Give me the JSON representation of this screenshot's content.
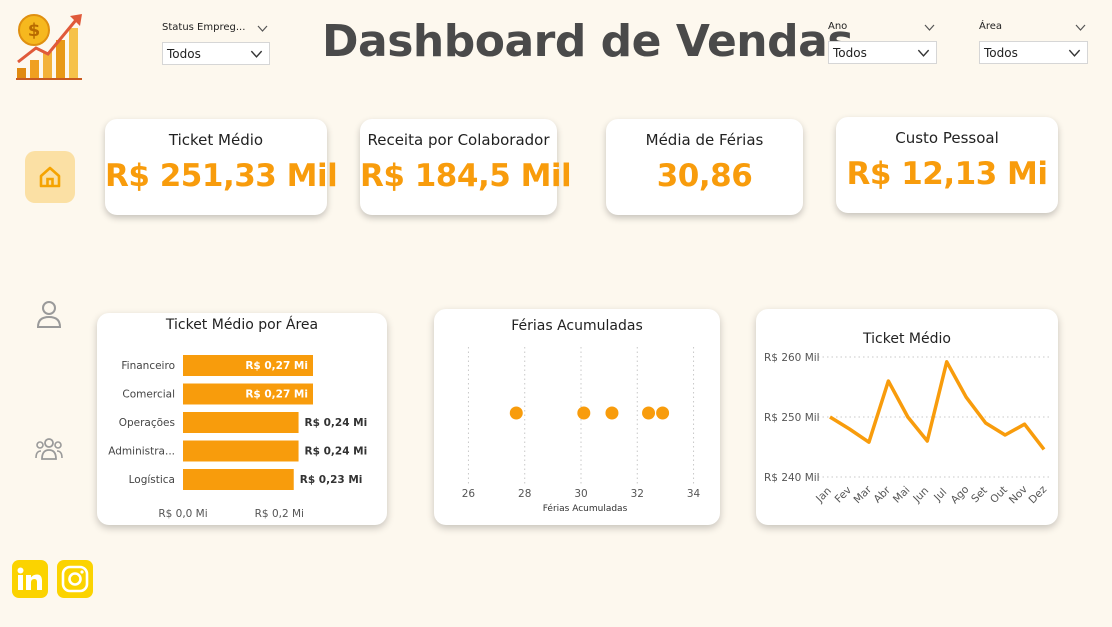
{
  "header": {
    "title": "Dashboard de Vendas"
  },
  "slicers": {
    "status": {
      "label": "Status Empreg...",
      "value": "Todos"
    },
    "ano": {
      "label": "Ano",
      "value": "Todos"
    },
    "area": {
      "label": "Área",
      "value": "Todos"
    }
  },
  "kpis": [
    {
      "title": "Ticket Médio",
      "value": "R$ 251,33 Mil"
    },
    {
      "title": "Receita por Colaborador",
      "value": "R$ 184,5 Mil"
    },
    {
      "title": "Média de Férias",
      "value": "30,86"
    },
    {
      "title": "Custo Pessoal",
      "value": "R$ 12,13 Mi"
    }
  ],
  "colors": {
    "accent": "#f89c0c",
    "background": "#fdf8ee",
    "title": "#4a4a4a",
    "nav_active": "#fbe0a4",
    "social": "#fbd300"
  },
  "nav": {
    "items": [
      "home-icon",
      "user-icon",
      "team-icon"
    ]
  },
  "social": [
    "linkedin-icon",
    "instagram-icon"
  ],
  "chart_data": [
    {
      "type": "bar",
      "orientation": "horizontal",
      "title": "Ticket Médio por Área",
      "categories": [
        "Financeiro",
        "Comercial",
        "Operações",
        "Administra...",
        "Logística"
      ],
      "values": [
        0.27,
        0.27,
        0.24,
        0.24,
        0.23
      ],
      "data_labels": [
        "R$ 0,27 Mi",
        "R$ 0,27 Mi",
        "R$ 0,24 Mi",
        "R$ 0,24 Mi",
        "R$ 0,23 Mi"
      ],
      "x_ticks": [
        "R$ 0,0 Mi",
        "R$ 0,2 Mi"
      ],
      "xlim": [
        0,
        0.27
      ],
      "color": "#f89c0c"
    },
    {
      "type": "scatter",
      "title": "Férias Acumuladas",
      "xlabel": "Férias Acumuladas",
      "x": [
        27.7,
        30.1,
        31.1,
        32.4,
        32.9
      ],
      "y": [
        0,
        0,
        0,
        0,
        0
      ],
      "x_ticks": [
        26,
        28,
        30,
        32,
        34
      ],
      "xlim": [
        25.7,
        34.3
      ],
      "grid": true,
      "color": "#f89c0c"
    },
    {
      "type": "line",
      "title": "Ticket Médio",
      "categories": [
        "Jan",
        "Fev",
        "Mar",
        "Abr",
        "Mai",
        "Jun",
        "Jul",
        "Ago",
        "Set",
        "Out",
        "Nov",
        "Dez"
      ],
      "values": [
        250,
        248,
        245.8,
        256,
        250,
        246,
        259.2,
        253.3,
        249,
        247,
        248.8,
        244.6
      ],
      "y_ticks": [
        "R$ 240 Mil",
        "R$ 250 Mil",
        "R$ 260 Mil"
      ],
      "ylim": [
        240,
        260
      ],
      "grid": true,
      "color": "#f89c0c"
    }
  ]
}
